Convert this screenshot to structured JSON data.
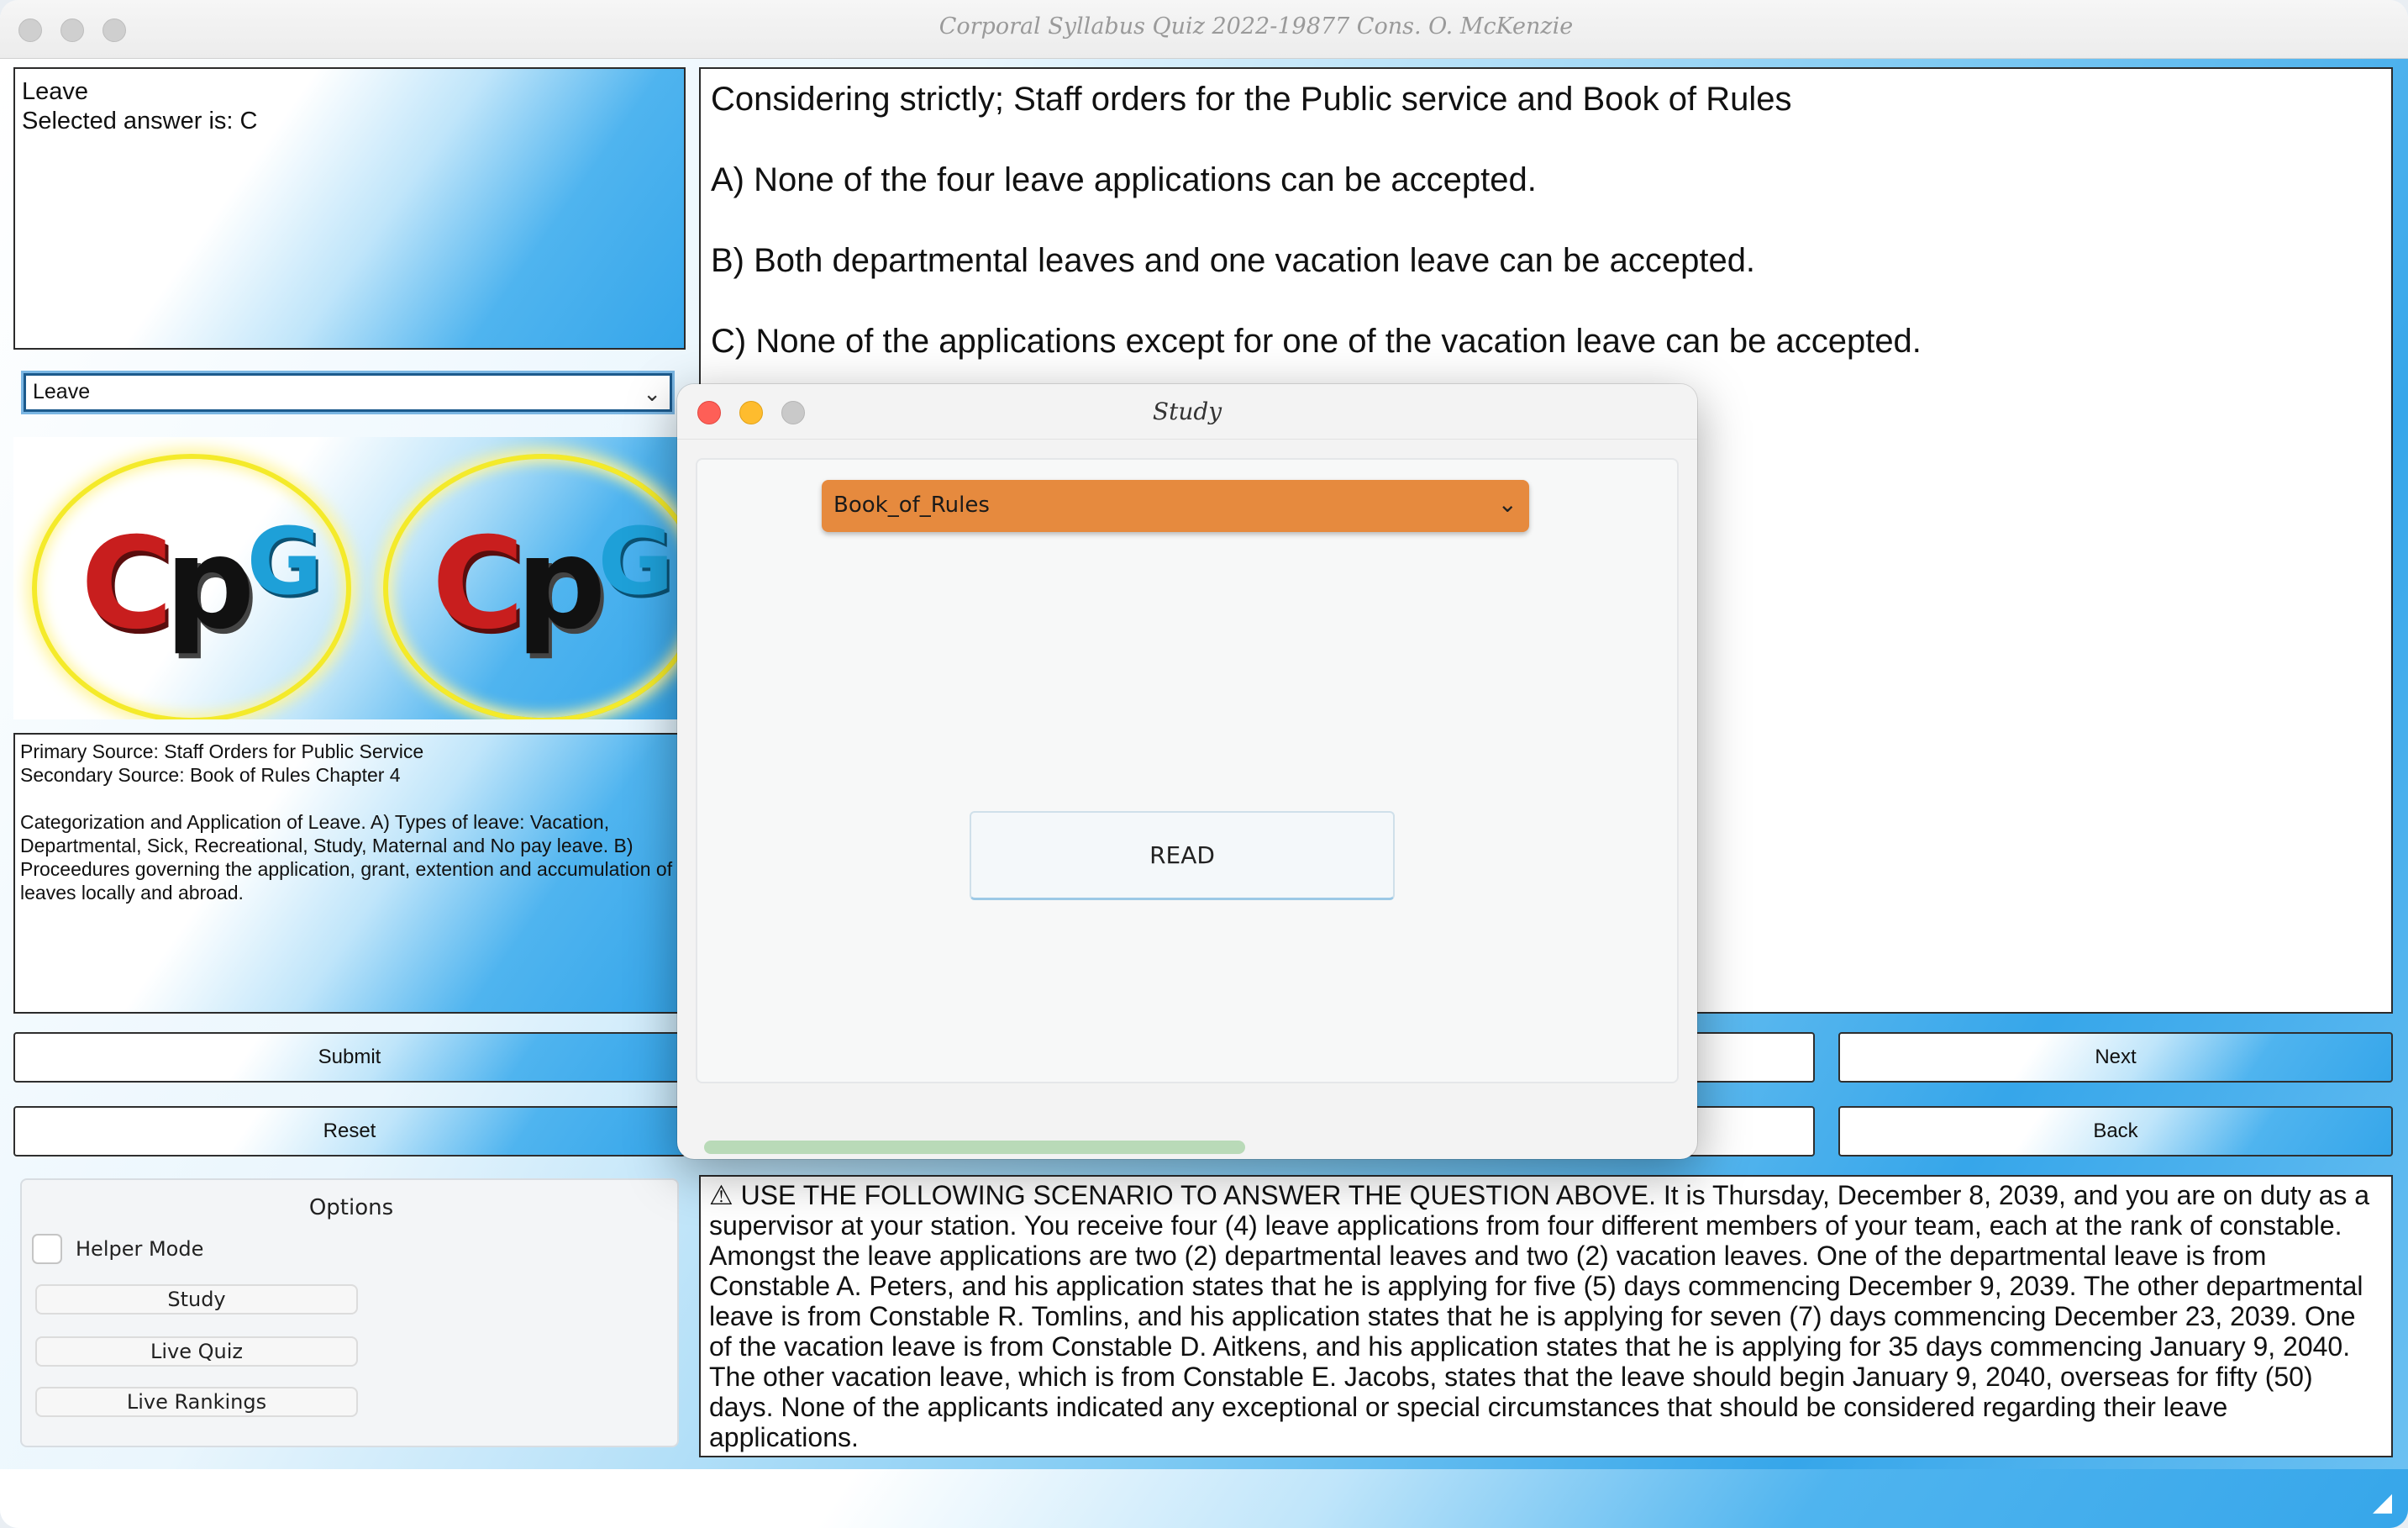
{
  "window": {
    "title": "Corporal Syllabus Quiz 2022-19877 Cons. O. McKenzie"
  },
  "left_panel": {
    "category_title": "Leave",
    "selected_answer": "Selected answer is: C",
    "category_select_value": "Leave",
    "logo_text": {
      "c": "C",
      "p": "p",
      "g": "G"
    },
    "source_lines": [
      "Primary Source: Staff Orders for Public Service",
      "Secondary Source: Book of Rules Chapter 4"
    ],
    "topic_description": "Categorization and Application of Leave. A) Types of leave: Vacation, Departmental, Sick, Recreational, Study, Maternal and No pay leave. B) Proceedures governing the application, grant, extention and accumulation of leaves locally and abroad.",
    "submit_label": "Submit",
    "reset_label": "Reset"
  },
  "options": {
    "title": "Options",
    "helper_mode_label": "Helper Mode",
    "helper_mode_checked": false,
    "study_label": "Study",
    "live_quiz_label": "Live Quiz",
    "live_rankings_label": "Live Rankings"
  },
  "question": {
    "prompt": "Considering strictly; Staff orders for the Public service and Book of Rules",
    "choices": [
      "A) None of the four leave applications can be accepted.",
      "B) Both departmental leaves and one vacation leave can be accepted.",
      "C) None of the applications except for one of the vacation leave can be accepted."
    ]
  },
  "nav": {
    "next_label": "Next",
    "back_label": "Back"
  },
  "scenario": {
    "warning_icon": "⚠",
    "text": "USE THE FOLLOWING SCENARIO TO ANSWER THE QUESTION ABOVE. It is Thursday, December 8, 2039, and you are on duty as a supervisor at your station. You receive four (4) leave applications from four different members of your team, each at the rank of constable. Amongst the leave applications are two (2) departmental leaves and two (2) vacation leaves. One of the departmental leave is from Constable A. Peters, and his application states that he is applying for five (5) days commencing December 9, 2039. The other departmental leave is from Constable R. Tomlins, and his application states that he is applying for seven (7) days commencing December 23, 2039. One of the vacation leave is from Constable D. Aitkens, and his application states that he is applying for 35 days commencing January 9, 2040. The other vacation leave, which is from Constable E. Jacobs, states that the leave should begin January 9, 2040, overseas for fifty (50) days. None of the applicants indicated any exceptional or special circumstances that should be considered regarding their leave applications."
  },
  "study_dialog": {
    "title": "Study",
    "source_select_value": "Book_of_Rules",
    "read_label": "READ"
  },
  "colors": {
    "accent_blue": "#36a6ea",
    "dropdown_orange": "#e68a3e",
    "close_red": "#fe5f57",
    "minimize_yellow": "#febc2e",
    "zoom_gray": "#c9c9c9"
  }
}
